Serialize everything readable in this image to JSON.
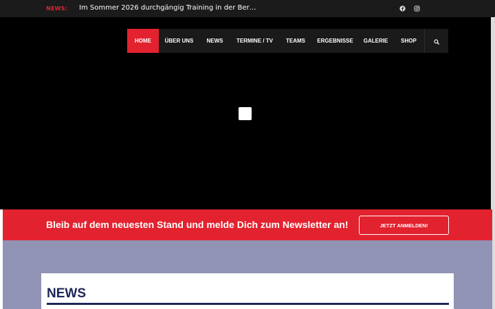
{
  "topbar": {
    "news_label": "NEWS:",
    "ticker_text": "Im Sommer 2026 durchgängig Training in der Ber…",
    "social_icons": [
      "facebook-icon",
      "instagram-icon"
    ]
  },
  "nav": {
    "items": [
      {
        "label": "HOME",
        "active": true
      },
      {
        "label": "ÜBER UNS",
        "active": false
      },
      {
        "label": "NEWS",
        "active": false
      },
      {
        "label": "TERMINE / TV",
        "active": false
      },
      {
        "label": "TEAMS",
        "active": false
      },
      {
        "label": "ERGEBNISSE",
        "active": false
      },
      {
        "label": "GALERIE",
        "active": false
      },
      {
        "label": "SHOP",
        "active": false
      }
    ],
    "search_icon": "search-icon"
  },
  "newsletter": {
    "text": "Bleib auf dem neuesten Stand und melde Dich zum Newsletter an!",
    "button_label": "JETZT ANMELDEN!"
  },
  "news_section": {
    "title": "NEWS"
  },
  "colors": {
    "accent": "#e3222f",
    "topbar_bg": "#1b1b1b",
    "nav_bg": "#1a1a1a",
    "section_bg": "#9093b3",
    "heading": "#1d2657"
  }
}
